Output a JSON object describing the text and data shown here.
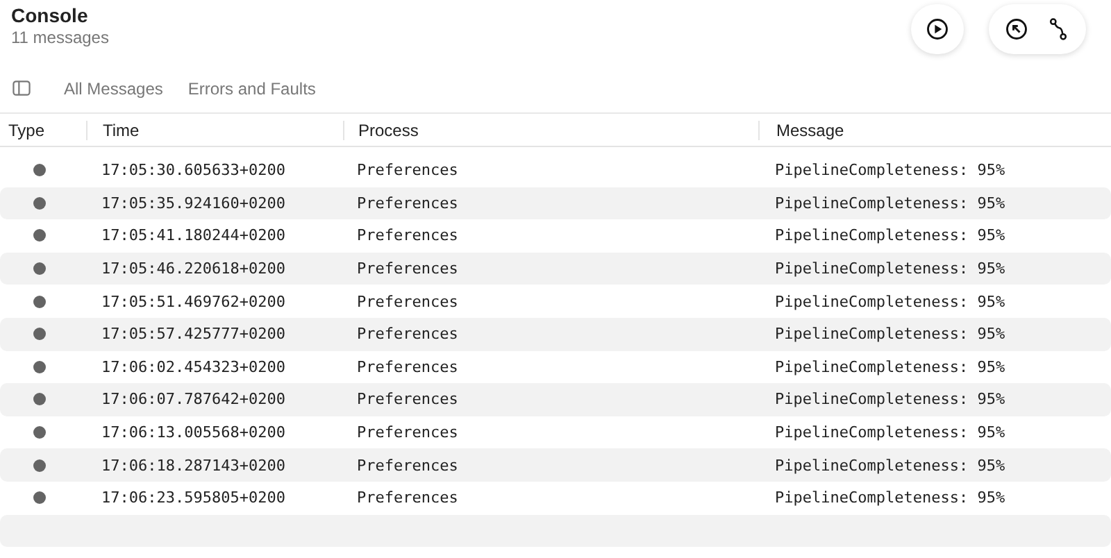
{
  "title": "Console",
  "subtitle": "11 messages",
  "tabs": [
    {
      "label": "All Messages",
      "selected": false
    },
    {
      "label": "Errors and Faults",
      "selected": false
    }
  ],
  "columns": [
    "Type",
    "Time",
    "Process",
    "Message"
  ],
  "rows": [
    {
      "color": "#646464",
      "time": "17:05:30.605633+0200",
      "process": "Preferences",
      "message": "PipelineCompleteness: 95%"
    },
    {
      "color": "#646464",
      "time": "17:05:35.924160+0200",
      "process": "Preferences",
      "message": "PipelineCompleteness: 95%"
    },
    {
      "color": "#646464",
      "time": "17:05:41.180244+0200",
      "process": "Preferences",
      "message": "PipelineCompleteness: 95%"
    },
    {
      "color": "#646464",
      "time": "17:05:46.220618+0200",
      "process": "Preferences",
      "message": "PipelineCompleteness: 95%"
    },
    {
      "color": "#646464",
      "time": "17:05:51.469762+0200",
      "process": "Preferences",
      "message": "PipelineCompleteness: 95%"
    },
    {
      "color": "#646464",
      "time": "17:05:57.425777+0200",
      "process": "Preferences",
      "message": "PipelineCompleteness: 95%"
    },
    {
      "color": "#646464",
      "time": "17:06:02.454323+0200",
      "process": "Preferences",
      "message": "PipelineCompleteness: 95%"
    },
    {
      "color": "#646464",
      "time": "17:06:07.787642+0200",
      "process": "Preferences",
      "message": "PipelineCompleteness: 95%"
    },
    {
      "color": "#646464",
      "time": "17:06:13.005568+0200",
      "process": "Preferences",
      "message": "PipelineCompleteness: 95%"
    },
    {
      "color": "#646464",
      "time": "17:06:18.287143+0200",
      "process": "Preferences",
      "message": "PipelineCompleteness: 95%"
    },
    {
      "color": "#646464",
      "time": "17:06:23.595805+0200",
      "process": "Preferences",
      "message": "PipelineCompleteness: 95%"
    }
  ]
}
